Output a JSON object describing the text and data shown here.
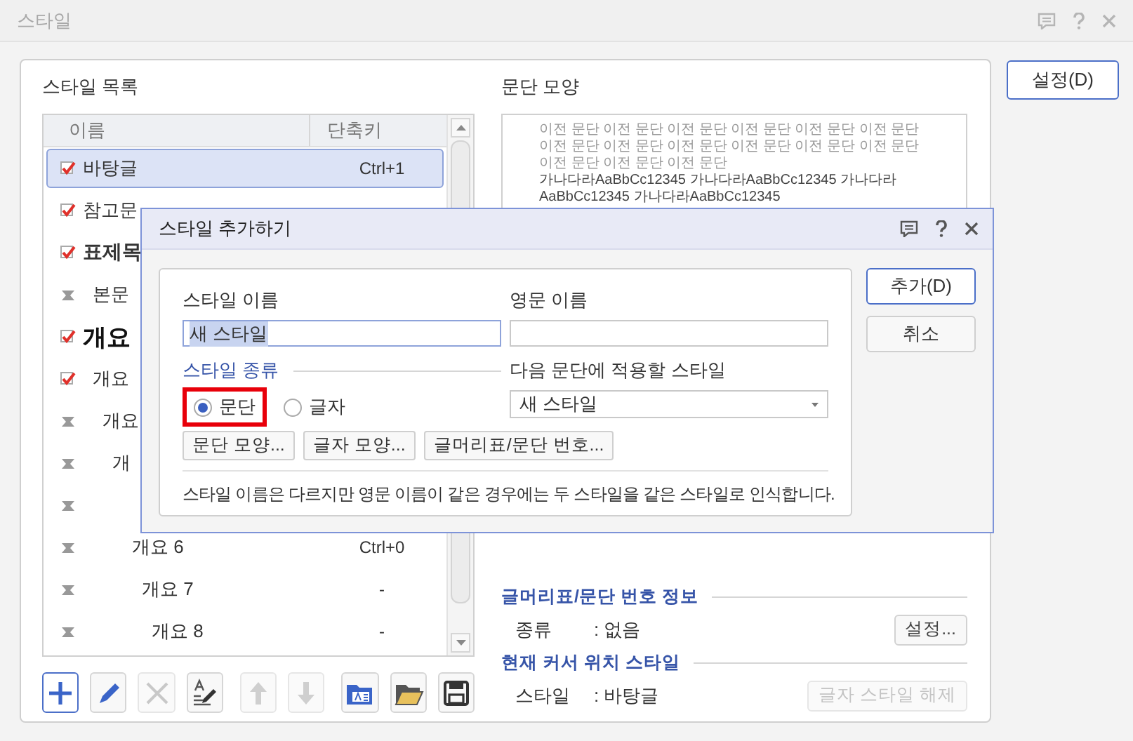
{
  "window": {
    "title": "스타일",
    "settings_button": "설정(D)"
  },
  "style_list": {
    "label": "스타일 목록",
    "columns": [
      "이름",
      "단축키"
    ],
    "rows": [
      {
        "name": "바탕글",
        "shortcut": "Ctrl+1",
        "checked": true,
        "kind": "normal",
        "selected": true
      },
      {
        "name": "참고문",
        "checked": true,
        "kind": "normal",
        "selected": false
      },
      {
        "name": "표제목",
        "checked": true,
        "kind": "bold",
        "selected": false,
        "children": [
          {
            "name": "본문",
            "checked": false,
            "kind": "normal",
            "selected": false
          }
        ]
      },
      {
        "name": "개요",
        "checked": true,
        "kind": "heading",
        "selected": false,
        "children": [
          {
            "name": "개요",
            "checked": true,
            "kind": "normal",
            "selected": false,
            "children": [
              {
                "name": "개요",
                "checked": false,
                "kind": "normal",
                "selected": false,
                "children": [
                  {
                    "name": "개",
                    "checked": false,
                    "kind": "normal",
                    "selected": false,
                    "children": [
                      {
                        "checked": false,
                        "selected": false,
                        "children": [
                          {
                            "name": "개요 6",
                            "shortcut": "Ctrl+0",
                            "checked": false,
                            "kind": "normal",
                            "selected": false,
                            "children": [
                              {
                                "name": "개요 7",
                                "shortcut": "-",
                                "checked": false,
                                "kind": "normal",
                                "selected": false,
                                "children": [
                                  {
                                    "name": "개요 8",
                                    "shortcut": "-",
                                    "checked": false,
                                    "kind": "normal",
                                    "selected": false
                                  }
                                ]
                              }
                            ]
                          }
                        ]
                      }
                    ]
                  }
                ]
              }
            ]
          }
        ]
      }
    ]
  },
  "toolbar": [
    {
      "selected": true,
      "disabled": false
    },
    {
      "selected": false,
      "disabled": false
    },
    {
      "selected": false,
      "disabled": true
    },
    {
      "selected": false,
      "disabled": false
    },
    {
      "selected": false,
      "disabled": true
    },
    {
      "selected": false,
      "disabled": true
    },
    {
      "selected": false,
      "disabled": false
    },
    {
      "selected": false,
      "disabled": false
    },
    {
      "selected": false,
      "disabled": false
    }
  ],
  "paragraph_preview": {
    "label": "문단 모양",
    "previous_text": "이전 문단 이전 문단 이전 문단 이전 문단 이전 문단 이전 문단 이전 문단 이전 문단 이전 문단 이전 문단 이전 문단 이전 문단 이전 문단 이전 문단 이전 문단",
    "sample_text": "가나다라AaBbCc12345 가나다라AaBbCc12345 가나다라AaBbCc12345 가나다라AaBbCc12345"
  },
  "bullet_info": {
    "heading": "글머리표/문단 번호 정보",
    "label": "종류",
    "value": ": 없음",
    "button": "설정...",
    "button_disabled": false
  },
  "cursor_style": {
    "heading": "현재 커서 위치 스타일",
    "label": "스타일",
    "value": ": 바탕글",
    "button": "글자 스타일 해제",
    "button_disabled": true
  },
  "dialog": {
    "title": "스타일 추가하기",
    "style_name": {
      "label": "스타일 이름",
      "value": "새 스타일"
    },
    "english_name": {
      "label": "영문 이름"
    },
    "style_type": {
      "label": "스타일 종류",
      "options": [
        {
          "label": "문단",
          "selected": true,
          "highlighted": true
        },
        {
          "label": "글자",
          "selected": false,
          "highlighted": false
        }
      ]
    },
    "next_style": {
      "label": "다음 문단에 적용할 스타일",
      "value": "새 스타일"
    },
    "buttons": [
      "문단 모양...",
      "글자 모양...",
      "글머리표/문단 번호..."
    ],
    "note": "스타일 이름은 다르지만 영문 이름이 같은 경우에는 두 스타일을 같은 스타일로 인식합니다.",
    "side_buttons": [
      {
        "label": "추가(D)",
        "default": true
      },
      {
        "label": "취소",
        "default": false
      }
    ]
  }
}
